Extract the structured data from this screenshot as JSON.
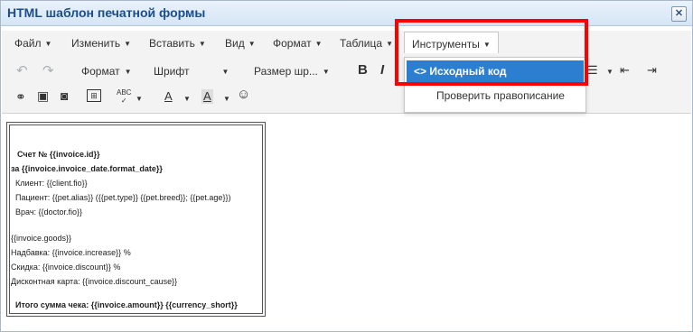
{
  "window": {
    "title": "HTML шаблон печатной формы",
    "close_glyph": "✕"
  },
  "menubar": {
    "items": [
      {
        "label": "Файл"
      },
      {
        "label": "Изменить"
      },
      {
        "label": "Вставить"
      },
      {
        "label": "Вид"
      },
      {
        "label": "Формат"
      },
      {
        "label": "Таблица"
      },
      {
        "label": "Инструменты"
      }
    ],
    "active_index": 6
  },
  "toolbar": {
    "format_label": "Формат",
    "font_label": "Шрифт",
    "size_label": "Размер шр...",
    "bold": "B",
    "italic": "I",
    "text_color": "A",
    "bg_color": "A",
    "spell_text": "ABC"
  },
  "dropdown": {
    "items": [
      {
        "icon": "<>",
        "label": "Исходный код"
      },
      {
        "label": "Проверить правописание"
      }
    ],
    "selected_index": 0
  },
  "document": {
    "lines": [
      "Счет № {{invoice.id}}",
      "за {{invoice.invoice_date.format_date}}",
      "Клиент: {{client.fio}}",
      "Пациент: {{pet.alias}} ({{pet.type}} {{pet.breed}}; {{pet.age}})",
      "Врач: {{doctor.fio}}",
      "{{invoice.goods}}",
      "Надбавка: {{invoice.increase}} %",
      "Скидка: {{invoice.discount}} %",
      "Дисконтная карта: {{invoice.discount_cause}}",
      "Итого сумма чека: {{invoice.amount}} {{currency_short}}"
    ]
  },
  "colors": {
    "accent": "#2c7fd0",
    "title": "#1b4d8c",
    "highlight": "#ff0000"
  }
}
